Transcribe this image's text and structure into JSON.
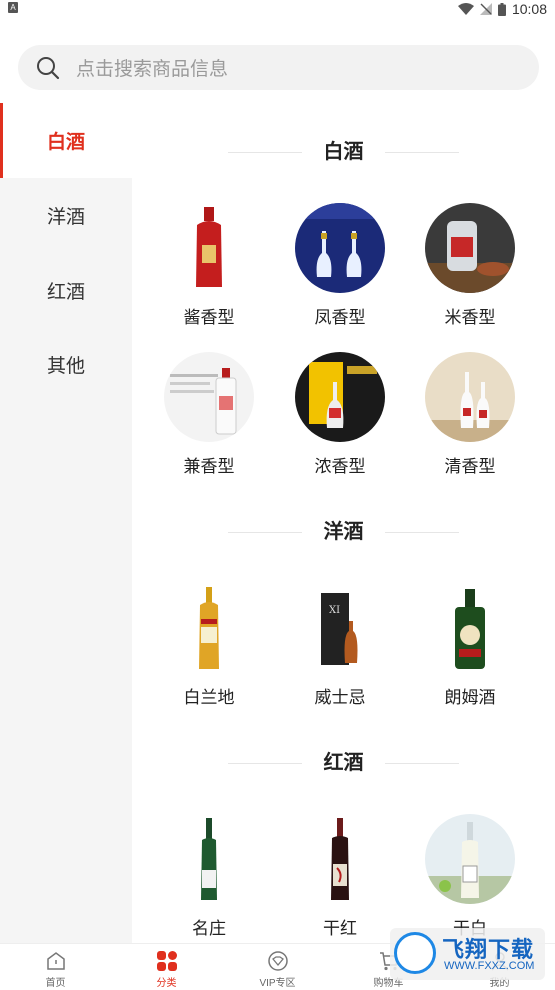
{
  "status_bar": {
    "left_glyph": "A",
    "time": "10:08"
  },
  "search": {
    "placeholder": "点击搜索商品信息"
  },
  "sidebar": {
    "items": [
      {
        "label": "白酒",
        "active": true
      },
      {
        "label": "洋酒",
        "active": false
      },
      {
        "label": "红酒",
        "active": false
      },
      {
        "label": "其他",
        "active": false
      }
    ]
  },
  "sections": [
    {
      "title": "白酒",
      "items": [
        {
          "label": "酱香型",
          "icon": "baijiu-red-bottle"
        },
        {
          "label": "凤香型",
          "icon": "baijiu-clear-bottles"
        },
        {
          "label": "米香型",
          "icon": "baijiu-jar"
        },
        {
          "label": "兼香型",
          "icon": "baijiu-white-bottle"
        },
        {
          "label": "浓香型",
          "icon": "baijiu-gift-box"
        },
        {
          "label": "清香型",
          "icon": "baijiu-two-bottles"
        }
      ]
    },
    {
      "title": "洋酒",
      "items": [
        {
          "label": "白兰地",
          "icon": "brandy-bottle"
        },
        {
          "label": "威士忌",
          "icon": "whisky-box"
        },
        {
          "label": "朗姆酒",
          "icon": "green-bottle"
        }
      ]
    },
    {
      "title": "红酒",
      "items": [
        {
          "label": "名庄",
          "icon": "green-wine-bottle"
        },
        {
          "label": "干红",
          "icon": "dark-wine-bottle"
        },
        {
          "label": "干白",
          "icon": "white-wine-bottle"
        }
      ]
    }
  ],
  "tabbar": {
    "items": [
      {
        "label": "首页",
        "icon": "home-icon"
      },
      {
        "label": "分类",
        "icon": "category-icon",
        "active": true
      },
      {
        "label": "VIP专区",
        "icon": "vip-icon"
      },
      {
        "label": "购物车",
        "icon": "cart-icon"
      },
      {
        "label": "我的",
        "icon": "profile-icon"
      }
    ]
  },
  "watermark": {
    "title": "飞翔下载",
    "url": "WWW.FXXZ.COM"
  },
  "colors": {
    "accent": "#e0301e",
    "sidebar_bg": "#f5f5f5"
  }
}
